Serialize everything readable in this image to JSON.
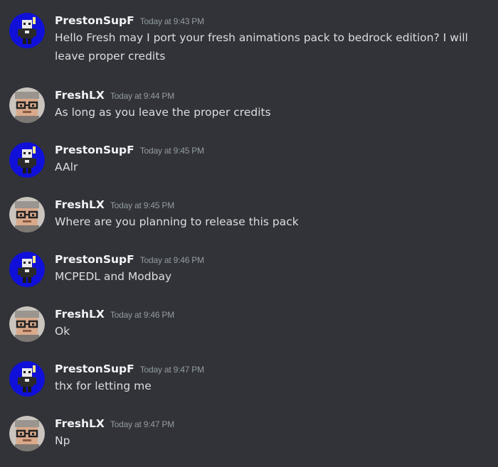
{
  "users": {
    "preston": {
      "name": "PrestonSupF",
      "avatar_icon": "pixel-character-avatar-icon",
      "avatar_bg": "#1010d8"
    },
    "fresh": {
      "name": "FreshLX",
      "avatar_icon": "glasses-face-avatar-icon",
      "avatar_bg": "#c9c4bd"
    }
  },
  "messages": [
    {
      "user": "PrestonSupF",
      "time": "Today at 9:43 PM",
      "text": "Hello Fresh may I port your fresh animations pack to bedrock edition? I will leave proper credits"
    },
    {
      "user": "FreshLX",
      "time": "Today at 9:44 PM",
      "text": "As long as you leave the proper credits"
    },
    {
      "user": "PrestonSupF",
      "time": "Today at 9:45 PM",
      "text": "AAlr"
    },
    {
      "user": "FreshLX",
      "time": "Today at 9:45 PM",
      "text": "Where are you planning to release this pack"
    },
    {
      "user": "PrestonSupF",
      "time": "Today at 9:46 PM",
      "text": "MCPEDL and Modbay"
    },
    {
      "user": "FreshLX",
      "time": "Today at 9:46 PM",
      "text": "Ok"
    },
    {
      "user": "PrestonSupF",
      "time": "Today at 9:47 PM",
      "text": "thx for letting me"
    },
    {
      "user": "FreshLX",
      "time": "Today at 9:47 PM",
      "text": "Np"
    }
  ],
  "colors": {
    "background": "#313338",
    "username": "#f2f3f5",
    "timestamp": "#949ba4",
    "message_text": "#dbdee1"
  }
}
